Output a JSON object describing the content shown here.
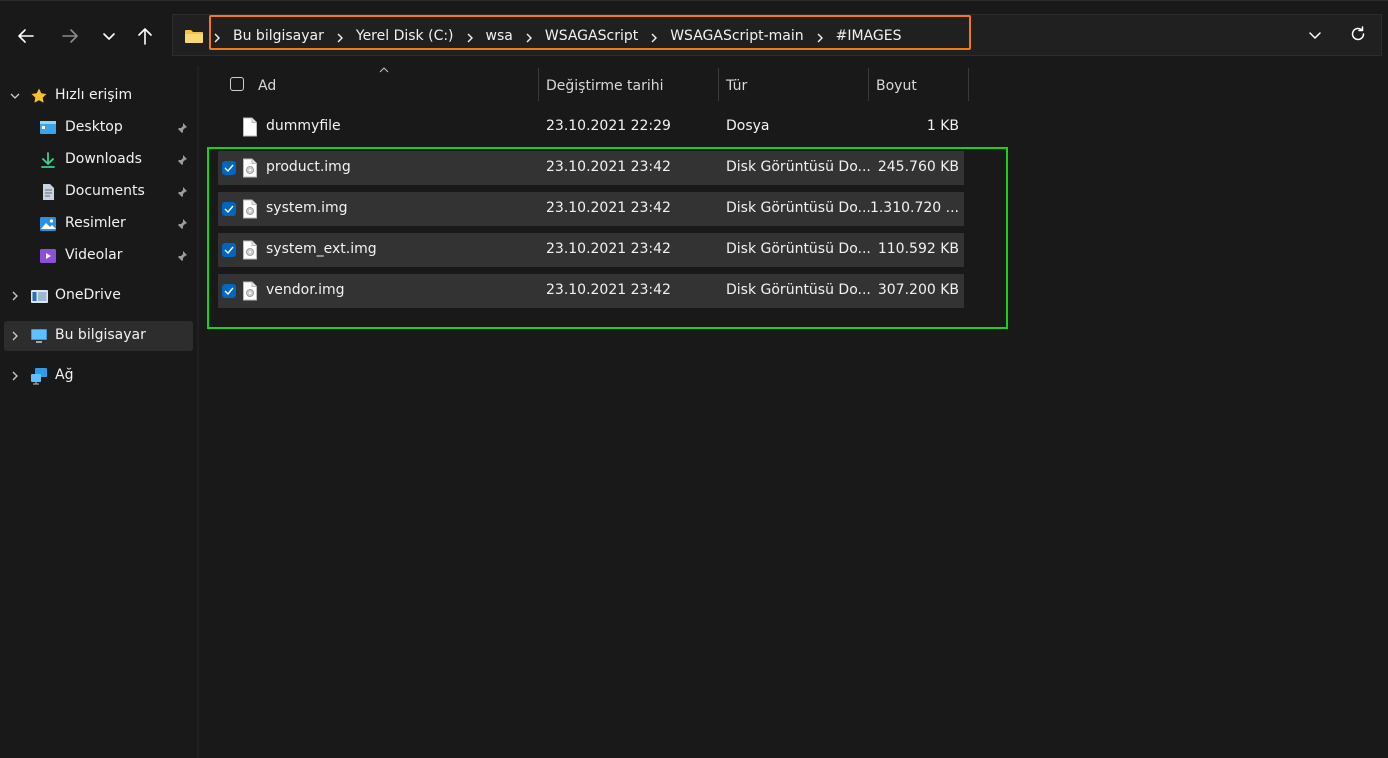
{
  "nav": {
    "back_icon": "arrow-left-icon",
    "forward_icon": "arrow-right-icon",
    "recent_icon": "chevron-down-icon",
    "up_icon": "arrow-up-icon"
  },
  "address_bar": {
    "crumbs": [
      "Bu bilgisayar",
      "Yerel Disk (C:)",
      "wsa",
      "WSAGAScript",
      "WSAGAScript-main",
      "#IMAGES"
    ],
    "highlight_color": "#f07a1a"
  },
  "sidebar": {
    "quick_access": {
      "label": "Hızlı erişim",
      "icon": "star-icon"
    },
    "pinned": [
      {
        "label": "Desktop",
        "icon": "desktop-icon"
      },
      {
        "label": "Downloads",
        "icon": "download-icon"
      },
      {
        "label": "Documents",
        "icon": "document-icon"
      },
      {
        "label": "Resimler",
        "icon": "pictures-icon"
      },
      {
        "label": "Videolar",
        "icon": "video-icon"
      }
    ],
    "onedrive": {
      "label": "OneDrive",
      "icon": "onedrive-icon"
    },
    "this_pc": {
      "label": "Bu bilgisayar",
      "icon": "computer-icon",
      "selected": true
    },
    "network": {
      "label": "Ağ",
      "icon": "network-icon"
    }
  },
  "columns": {
    "name": "Ad",
    "modified": "Değiştirme tarihi",
    "type": "Tür",
    "size": "Boyut"
  },
  "files": [
    {
      "name": "dummyfile",
      "modified": "23.10.2021 22:29",
      "type": "Dosya",
      "size": "1 KB",
      "selected": false
    },
    {
      "name": "product.img",
      "modified": "23.10.2021 23:42",
      "type": "Disk Görüntüsü Do...",
      "size": "245.760 KB",
      "selected": true
    },
    {
      "name": "system.img",
      "modified": "23.10.2021 23:42",
      "type": "Disk Görüntüsü Do...",
      "size": "1.310.720 ...",
      "selected": true
    },
    {
      "name": "system_ext.img",
      "modified": "23.10.2021 23:42",
      "type": "Disk Görüntüsü Do...",
      "size": "110.592 KB",
      "selected": true
    },
    {
      "name": "vendor.img",
      "modified": "23.10.2021 23:42",
      "type": "Disk Görüntüsü Do...",
      "size": "307.200 KB",
      "selected": true
    }
  ],
  "selection_highlight_color": "#16d316"
}
